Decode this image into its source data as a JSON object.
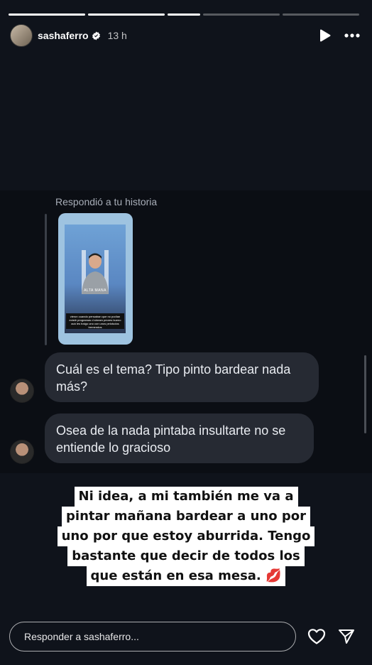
{
  "progress": [
    1,
    1,
    1,
    0,
    0
  ],
  "header": {
    "username": "sashaferro",
    "time": "13 h"
  },
  "dm": {
    "reply_label": "Respondió a tu historia",
    "thumb_caption": "vieron cuando pensaban que no podían existir programas d stream peores bueno acá les traigo uno con unos pelotudos tremendos",
    "thumb_logo": "ALTA MANA",
    "messages": [
      "Cuál es el tema? Tipo pinto bardear nada más?",
      "Osea de la nada pintaba insultarte no se entiende lo gracioso"
    ]
  },
  "sticker": {
    "lines": [
      "Ni idea, a mi también me va a",
      "pintar mañana bardear a uno por",
      "uno por que estoy aburrida. Tengo",
      "bastante que decir de todos los",
      "que están en esa mesa. 💋"
    ]
  },
  "footer": {
    "reply_placeholder": "Responder a sashaferro..."
  },
  "icons": {
    "play": "play-icon",
    "more": "more-icon",
    "like": "heart-icon",
    "share": "send-icon",
    "verified": "verified-icon"
  }
}
